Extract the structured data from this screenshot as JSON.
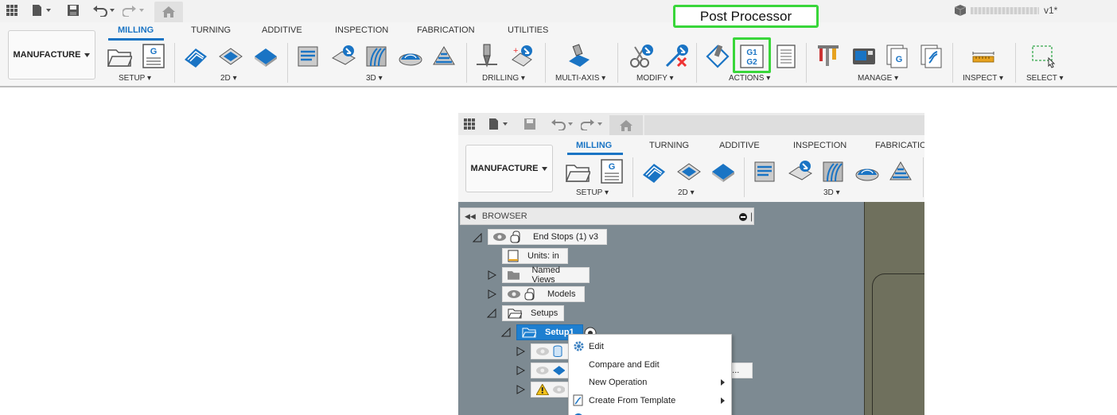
{
  "callout": {
    "label": "Post Processor"
  },
  "document": {
    "version_suffix": "v1*"
  },
  "workspace": {
    "label": "MANUFACTURE"
  },
  "tabs": [
    "MILLING",
    "TURNING",
    "ADDITIVE",
    "INSPECTION",
    "FABRICATION",
    "UTILITIES"
  ],
  "groups": [
    "SETUP",
    "2D",
    "3D",
    "DRILLING",
    "MULTI-AXIS",
    "MODIFY",
    "ACTIONS",
    "MANAGE",
    "INSPECT",
    "SELECT"
  ],
  "inset": {
    "tabs": [
      "MILLING",
      "TURNING",
      "ADDITIVE",
      "INSPECTION",
      "FABRICATION"
    ],
    "groups": [
      "SETUP",
      "2D",
      "3D"
    ],
    "browser": {
      "title": "BROWSER",
      "root": "End Stops (1) v3",
      "units": "Units: in",
      "named_views": "Named Views",
      "models": "Models",
      "setups": "Setups",
      "setup1": "Setup1",
      "truncated_node": "m..."
    },
    "context_menu": [
      "Edit",
      "Compare and Edit",
      "New Operation",
      "Create From Template"
    ]
  },
  "colors": {
    "accent": "#1a74c4",
    "highlight": "#39d63a",
    "selection": "#1e7fd0"
  }
}
